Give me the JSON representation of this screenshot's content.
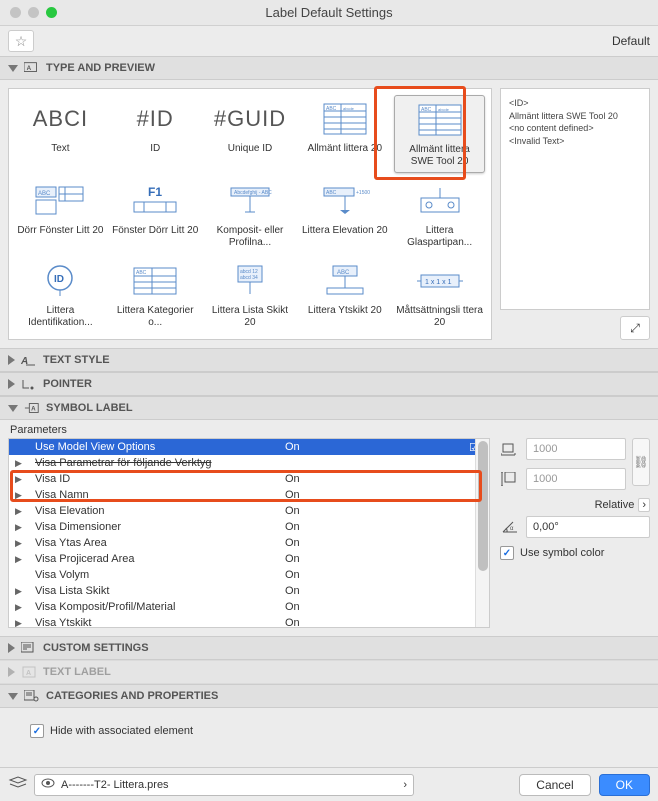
{
  "window": {
    "title": "Label Default Settings"
  },
  "toolbar": {
    "default_link": "Default"
  },
  "sections": {
    "type_preview": "TYPE AND PREVIEW",
    "text_style": "TEXT STYLE",
    "pointer": "POINTER",
    "symbol_label": "SYMBOL LABEL",
    "custom_settings": "CUSTOM SETTINGS",
    "text_label": "TEXT LABEL",
    "categories": "CATEGORIES AND PROPERTIES"
  },
  "gallery": [
    {
      "label": "Text",
      "glyph": "ABCI",
      "big": true
    },
    {
      "label": "ID",
      "glyph": "#ID",
      "big": true
    },
    {
      "label": "Unique ID",
      "glyph": "#GUID",
      "big": true
    },
    {
      "label": "Allmänt littera 20",
      "svg": "table"
    },
    {
      "label": "Allmänt littera SWE Tool 20",
      "svg": "table",
      "selected": true
    },
    {
      "label": "Dörr Fönster Litt 20",
      "svg": "doorwin"
    },
    {
      "label": "Fönster Dörr Litt 20",
      "svg": "f1"
    },
    {
      "label": "Komposit- eller Profilna...",
      "svg": "comp"
    },
    {
      "label": "Littera Elevation 20",
      "svg": "elev"
    },
    {
      "label": "Littera Glaspartipan...",
      "svg": "glass"
    },
    {
      "label": "Littera Identifikation...",
      "svg": "id"
    },
    {
      "label": "Littera Kategorier o...",
      "svg": "kat"
    },
    {
      "label": "Littera Lista Skikt 20",
      "svg": "lista"
    },
    {
      "label": "Littera Ytskikt 20",
      "svg": "yts"
    },
    {
      "label": "Måttsättningsli ttera 20",
      "svg": "dim"
    }
  ],
  "preview": {
    "lines": [
      "<ID>",
      "Allmänt littera SWE Tool 20",
      "<no content defined>",
      "<Invalid Text>"
    ]
  },
  "parameters": {
    "label": "Parameters",
    "rows": [
      {
        "name": "Use Model View Options",
        "value": "On",
        "selected": true,
        "checked": true,
        "arrow": false
      },
      {
        "name": "Visa Parametrar för följande Verktyg",
        "value": "",
        "strike": true,
        "arrow": true
      },
      {
        "name": "Visa ID",
        "value": "On",
        "arrow": true
      },
      {
        "name": "Visa Namn",
        "value": "On",
        "arrow": true
      },
      {
        "name": "Visa Elevation",
        "value": "On",
        "arrow": true
      },
      {
        "name": "Visa Dimensioner",
        "value": "On",
        "arrow": true
      },
      {
        "name": "Visa Ytas Area",
        "value": "On",
        "arrow": true
      },
      {
        "name": "Visa Projicerad Area",
        "value": "On",
        "arrow": true
      },
      {
        "name": "Visa Volym",
        "value": "On",
        "arrow": false
      },
      {
        "name": "Visa Lista Skikt",
        "value": "On",
        "arrow": true
      },
      {
        "name": "Visa Komposit/Profil/Material",
        "value": "On",
        "arrow": true
      },
      {
        "name": "Visa Ytskikt",
        "value": "On",
        "arrow": true
      }
    ]
  },
  "controls": {
    "width_value": "1000",
    "height_value": "1000",
    "relative_label": "Relative",
    "angle_value": "0,00°",
    "use_symbol_color": "Use symbol color"
  },
  "categories": {
    "hide_label": "Hide with associated element"
  },
  "footer": {
    "layer": "A-------T2- Littera.pres",
    "cancel": "Cancel",
    "ok": "OK"
  }
}
